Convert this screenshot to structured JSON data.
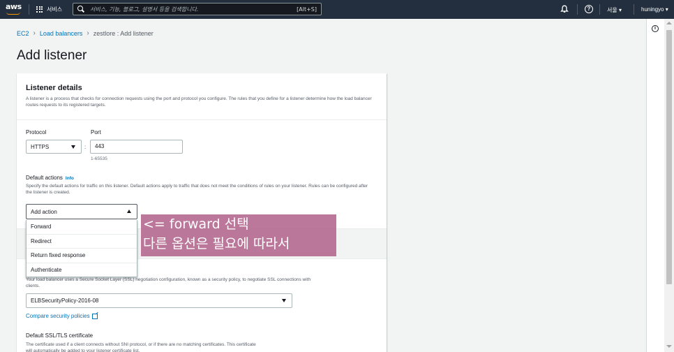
{
  "topnav": {
    "logo_text": "aws",
    "services_label": "서비스",
    "search_placeholder": "서비스, 기능, 블로그, 설명서 등을 검색합니다.",
    "search_shortcut": "[Alt+S]",
    "region": "서울 ▾",
    "user": "huningyo ▾",
    "help_glyph": "?",
    "background_color": "#232f3e",
    "accent_color": "#ff9900"
  },
  "breadcrumb": {
    "items": [
      "EC2",
      "Load balancers"
    ],
    "current": "zestlore : Add listener",
    "separator": "›"
  },
  "page": {
    "title": "Add listener"
  },
  "listener_details": {
    "title": "Listener details",
    "description": "A listener is a process that checks for connection requests using the port and protocol you configure. The rules that you define for a listener determine how the load balancer routes requests to its registered targets.",
    "protocol_label": "Protocol",
    "protocol_value": "HTTPS",
    "port_label": "Port",
    "port_value": "443",
    "port_hint": "1-65535",
    "colon": ":"
  },
  "default_actions": {
    "label": "Default actions",
    "info_link": "Info",
    "description": "Specify the default actions for traffic on this listener. Default actions apply to traffic that does not meet the conditions of rules on your listener. Rules can be configured after the listener is created.",
    "add_action_label": "Add action",
    "options": [
      "Forward",
      "Redirect",
      "Return fixed response",
      "Authenticate"
    ]
  },
  "secure_listener": {
    "description": "Your load balancer uses a Secure Socket Layer (SSL) negotiation configuration, known as a security policy, to negotiate SSL connections with clients.",
    "policy_value": "ELBSecurityPolicy-2016-08",
    "compare_link": "Compare security policies",
    "default_cert_title": "Default SSL/TLS certificate",
    "default_cert_desc": "The certificate used if a client connects without SNI protocol, or if there are no matching certificates. This certificate",
    "default_cert_desc_2": "will automatically be added to your listener certificate list."
  },
  "annotation": {
    "line1": "<= forward 선택",
    "line2": "다른 옵션은 필요에 따라서",
    "color": "#b0608a"
  },
  "right_rail": {
    "info_glyph": "i"
  }
}
